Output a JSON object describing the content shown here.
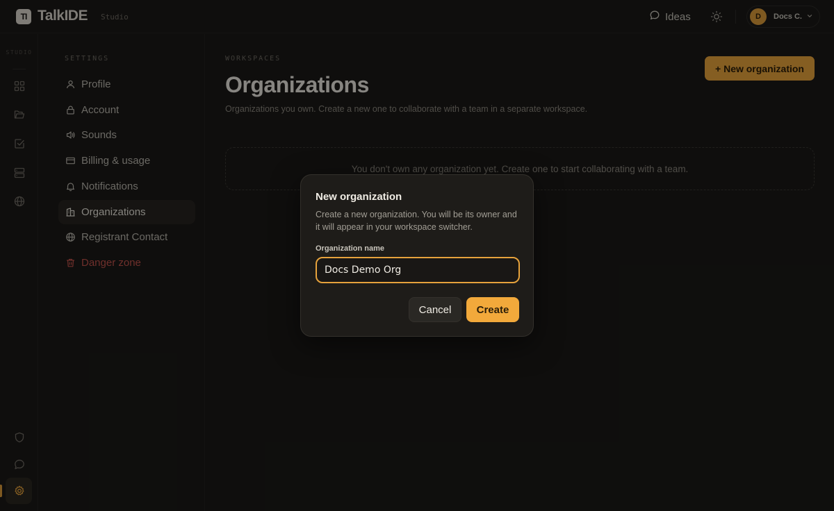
{
  "colors": {
    "accent": "#e6a23c",
    "danger": "#c0524a",
    "background": "#1a1917"
  },
  "app": {
    "logo_mark": "TI",
    "name": "TalkIDE",
    "sub": "Studio"
  },
  "topbar": {
    "ideas_label": "Ideas",
    "ideas_icon": "chat-bubble-icon",
    "theme_icon": "sun-icon",
    "user_initial": "D",
    "user_name": "Docs C."
  },
  "rail": {
    "title": "STUDIO",
    "icons": [
      "grid-icon",
      "folder-icon",
      "checkbox-icon",
      "server-icon",
      "globe-icon"
    ],
    "bottom_icons": [
      "shield-icon",
      "chat-icon",
      "gear-icon"
    ]
  },
  "settings": {
    "title": "SETTINGS",
    "items": [
      {
        "label": "Profile",
        "icon": "user-icon"
      },
      {
        "label": "Account",
        "icon": "lock-icon"
      },
      {
        "label": "Sounds",
        "icon": "speaker-icon"
      },
      {
        "label": "Billing & usage",
        "icon": "credit-card-icon"
      },
      {
        "label": "Notifications",
        "icon": "bell-icon"
      },
      {
        "label": "Organizations",
        "icon": "building-icon"
      },
      {
        "label": "Registrant Contact",
        "icon": "globe-icon"
      },
      {
        "label": "Danger zone",
        "icon": "trash-icon"
      }
    ]
  },
  "main": {
    "eyebrow": "WORKSPACES",
    "title": "Organizations",
    "description": "Organizations you own. Create a new one to collaborate with a team in a separate workspace.",
    "new_button": "+ New organization",
    "empty_state": "You don't own any organization yet. Create one to start collaborating with a team."
  },
  "modal": {
    "title": "New organization",
    "description": "Create a new organization. You will be its owner and it will appear in your workspace switcher.",
    "field_label": "Organization name",
    "field_value": "Docs Demo Org",
    "cancel_label": "Cancel",
    "create_label": "Create"
  }
}
